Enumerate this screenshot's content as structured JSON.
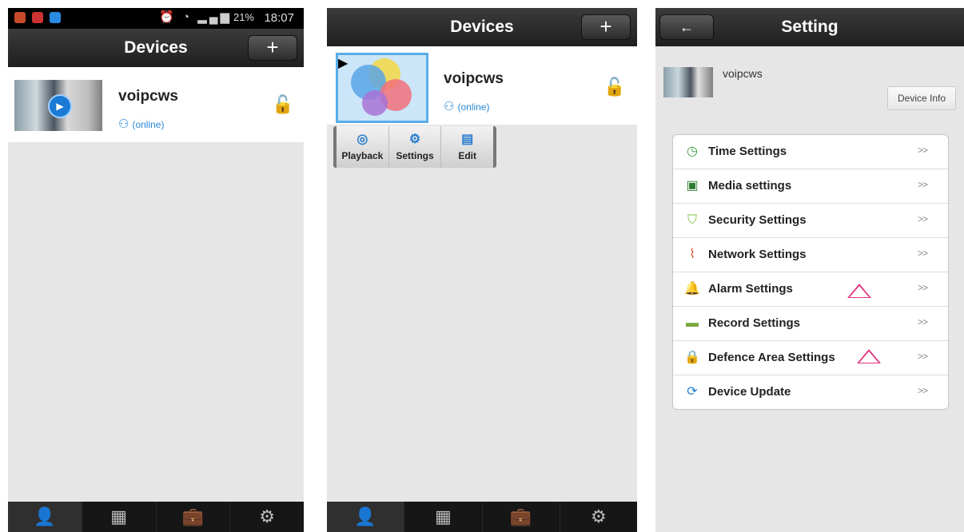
{
  "status_bar": {
    "battery": "21%",
    "time": "18:07"
  },
  "screen1": {
    "title": "Devices",
    "add_label": "+",
    "device": {
      "name": "voipcws",
      "status": "(online)"
    }
  },
  "screen2": {
    "title": "Devices",
    "add_label": "+",
    "device": {
      "name": "voipcws",
      "status": "(online)"
    },
    "popup": [
      {
        "label": "Playback",
        "icon": "playback-icon"
      },
      {
        "label": "Settings",
        "icon": "settings-icon"
      },
      {
        "label": "Edit",
        "icon": "edit-icon"
      }
    ]
  },
  "screen3": {
    "title": "Setting",
    "back_label": "←",
    "device_name": "voipcws",
    "device_info_label": "Device Info",
    "items": [
      {
        "label": "Time Settings",
        "icon": "clock-icon"
      },
      {
        "label": "Media settings",
        "icon": "clapper-icon"
      },
      {
        "label": "Security Settings",
        "icon": "shield-icon"
      },
      {
        "label": "Network Settings",
        "icon": "antenna-icon"
      },
      {
        "label": "Alarm Settings",
        "icon": "bell-icon"
      },
      {
        "label": "Record Settings",
        "icon": "camera-icon"
      },
      {
        "label": "Defence Area Settings",
        "icon": "lock-icon"
      },
      {
        "label": "Device Update",
        "icon": "update-icon"
      }
    ],
    "arrow": ">>"
  },
  "tabs": [
    "contacts-icon",
    "keypad-icon",
    "toolbox-icon",
    "gear-icon"
  ],
  "colors": {
    "accent": "#2a8be2",
    "titlebar": "#2b2b2b",
    "background": "#e6e6e6"
  }
}
